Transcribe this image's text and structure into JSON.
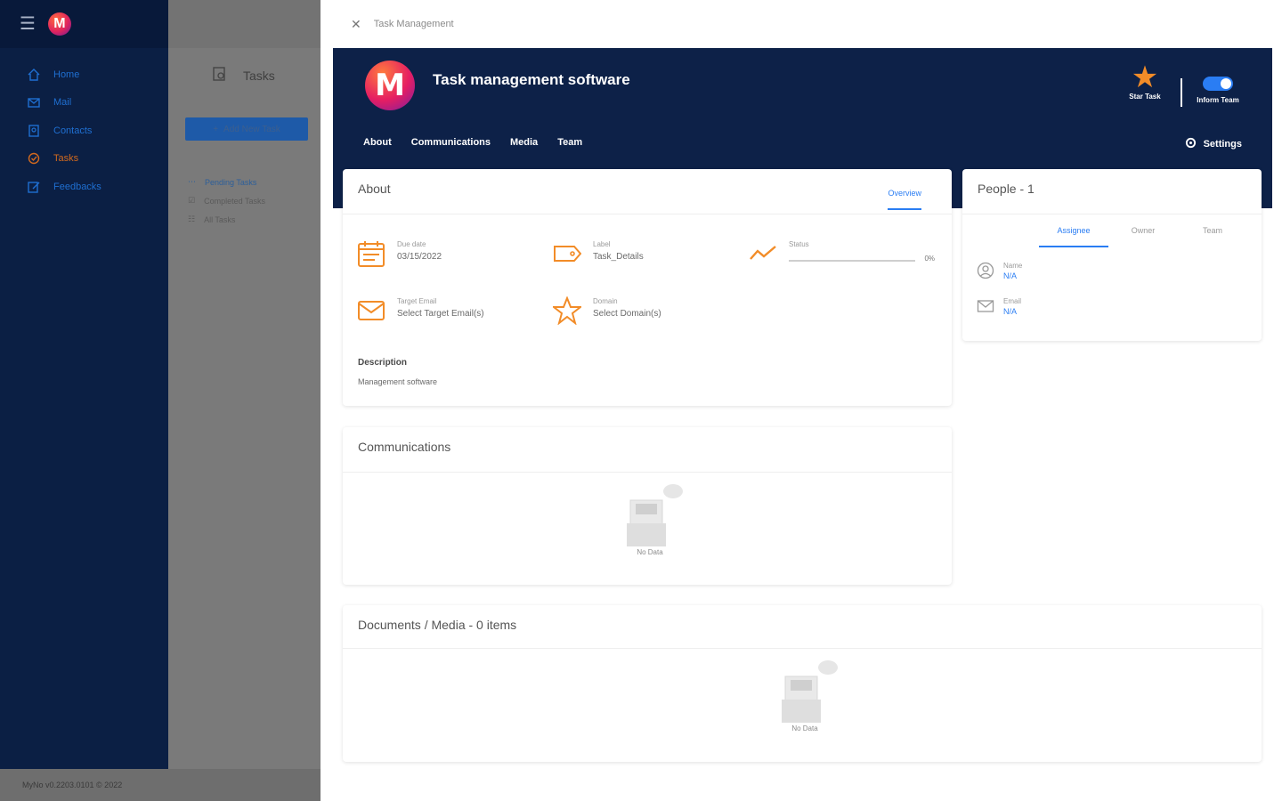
{
  "app": {
    "title": "Task Management",
    "version_footer": "MyNo v0.2203.0101 © 2022"
  },
  "sidebar": {
    "items": [
      {
        "label": "Home",
        "icon": "home-icon"
      },
      {
        "label": "Mail",
        "icon": "mail-icon"
      },
      {
        "label": "Contacts",
        "icon": "contacts-icon"
      },
      {
        "label": "Tasks",
        "icon": "tasks-icon",
        "active": true
      },
      {
        "label": "Feedbacks",
        "icon": "feedback-icon"
      }
    ]
  },
  "tasks_panel": {
    "title": "Tasks",
    "add_button": "Add New Task",
    "filters": [
      {
        "label": "Pending Tasks",
        "active": true
      },
      {
        "label": "Completed Tasks"
      },
      {
        "label": "All Tasks"
      }
    ]
  },
  "drawer": {
    "breadcrumb": "Task Management",
    "task_title": "Task management software",
    "star_label": "Star Task",
    "toggle_label": "Inform Team",
    "tabs": [
      "About",
      "Communications",
      "Media",
      "Team"
    ],
    "settings_label": "Settings"
  },
  "about": {
    "title": "About",
    "tab": "Overview",
    "fields": {
      "due_date_label": "Due date",
      "due_date_value": "03/15/2022",
      "label_label": "Label",
      "label_value": "Task_Details",
      "status_label": "Status",
      "status_value": "0%",
      "status_progress": 0,
      "target_email_label": "Target Email",
      "target_email_value": "Select Target Email(s)",
      "domain_label": "Domain",
      "domain_value": "Select Domain(s)"
    },
    "description_label": "Description",
    "description_value": "Management software"
  },
  "people": {
    "title": "People - 1",
    "tabs": [
      "Assignee",
      "Owner",
      "Team"
    ],
    "name_label": "Name",
    "name_value": "N/A",
    "email_label": "Email",
    "email_value": "N/A"
  },
  "communications": {
    "title": "Communications",
    "empty": "No Data"
  },
  "documents": {
    "title": "Documents / Media - 0 items",
    "empty": "No Data"
  },
  "colors": {
    "navy": "#0d2148",
    "accent_blue": "#2a7df3",
    "accent_orange": "#f28c28"
  }
}
